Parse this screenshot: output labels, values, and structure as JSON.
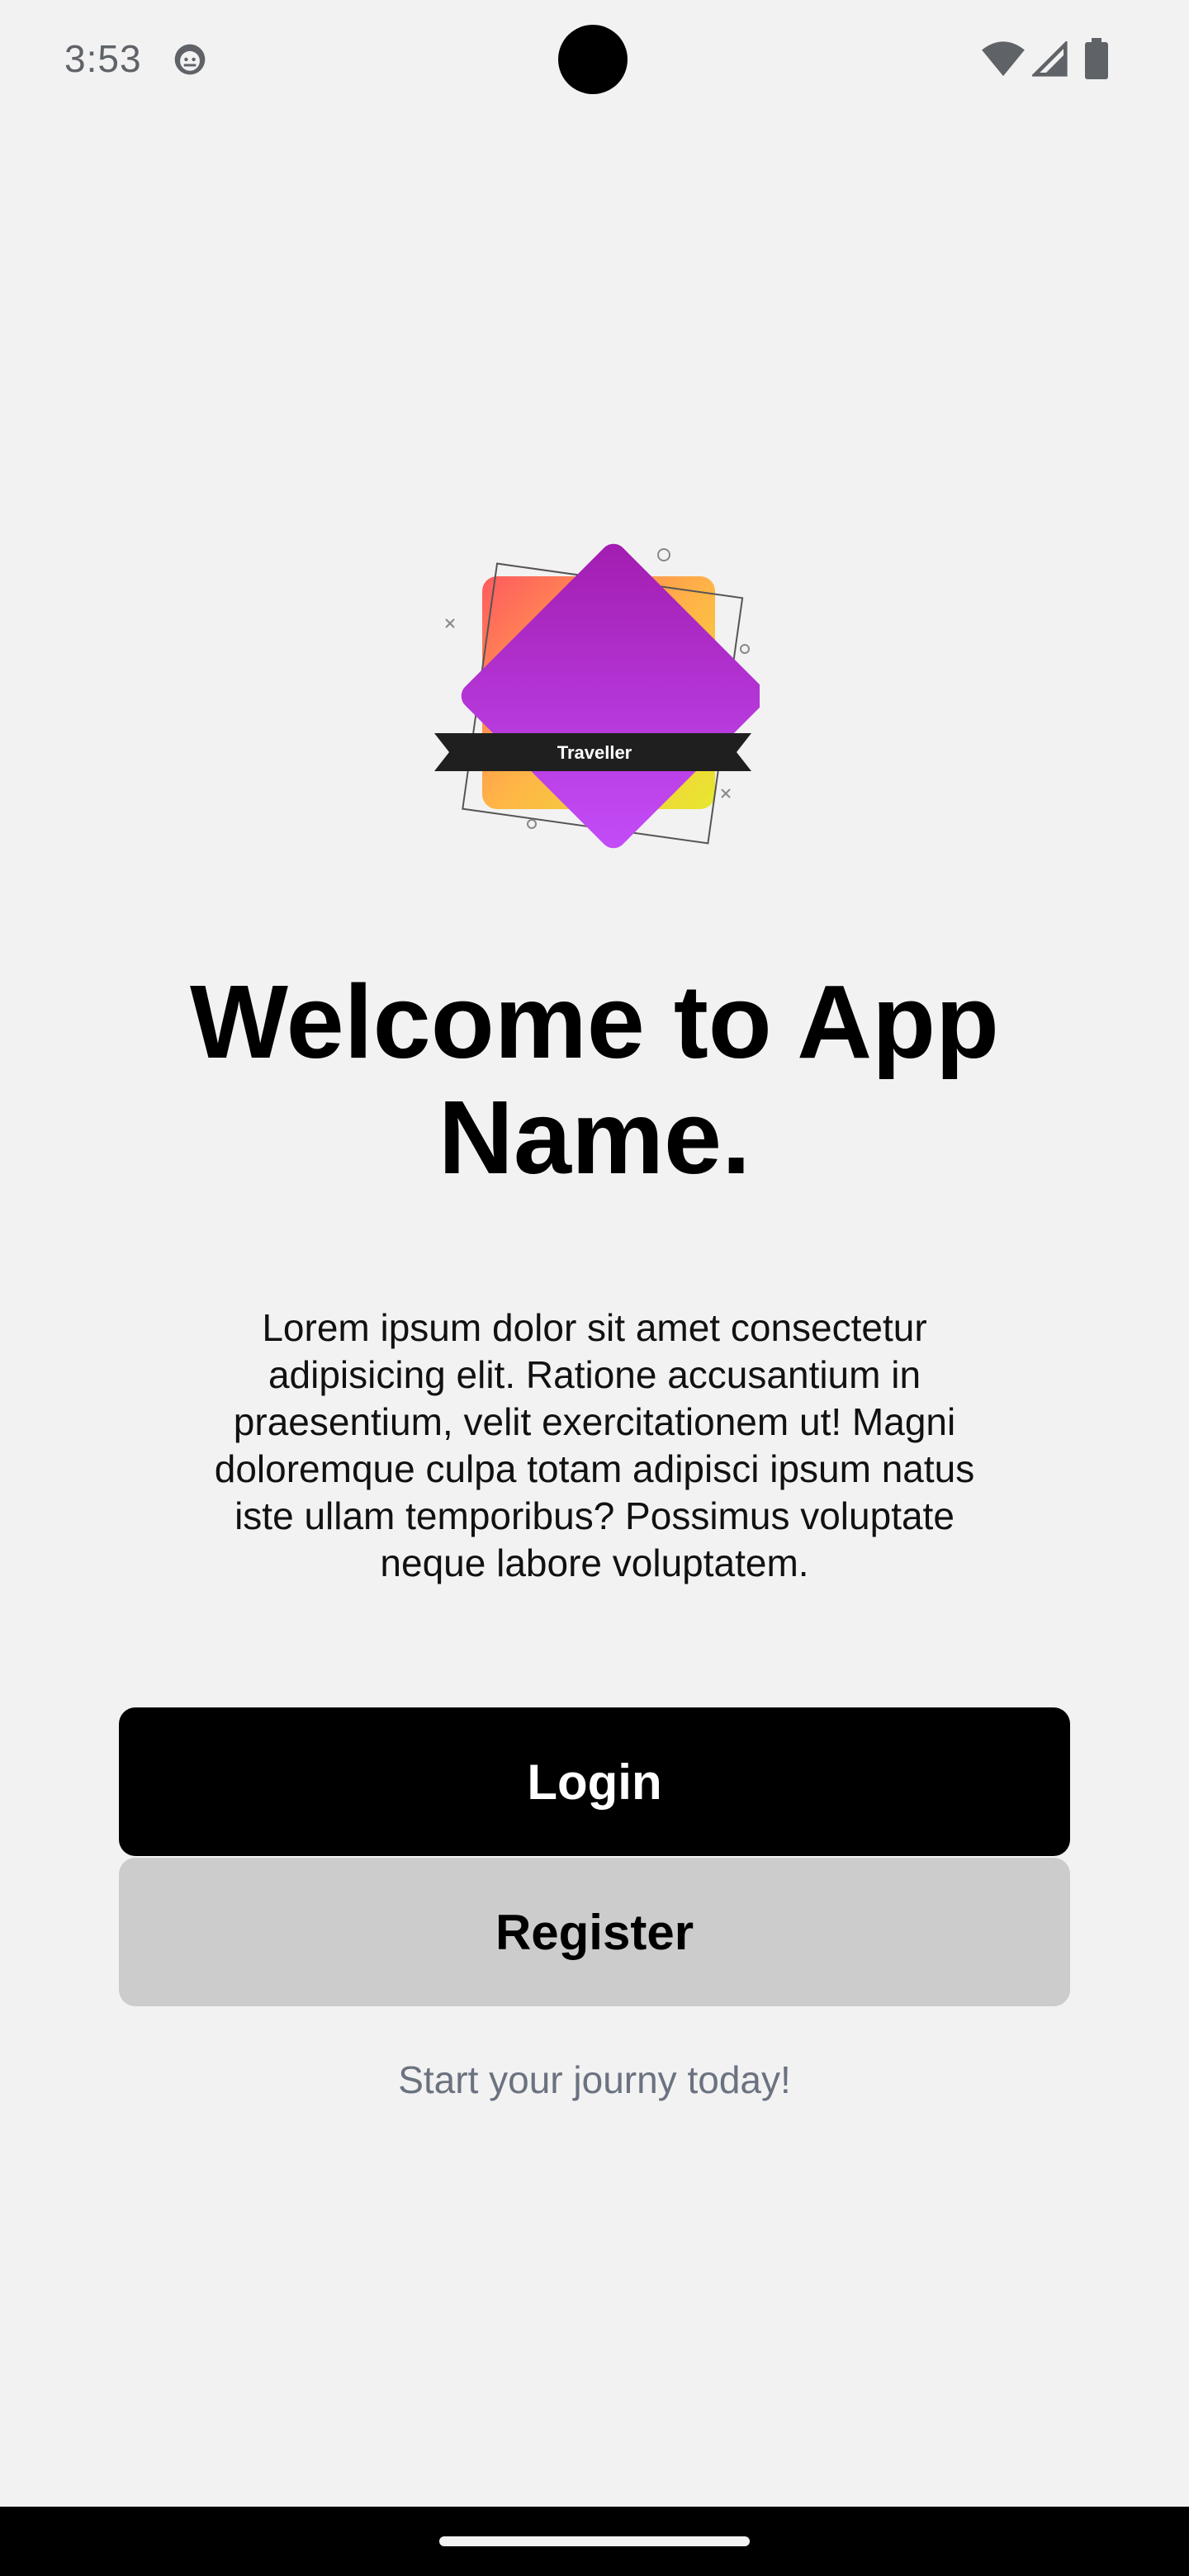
{
  "status_bar": {
    "time": "3:53",
    "app_icon": "android-debug-icon",
    "wifi_icon": "wifi-icon",
    "cell_icon": "cellular-signal-icon",
    "battery_icon": "battery-icon"
  },
  "logo": {
    "banner_text": "Traveller",
    "colors": {
      "diamond_start": "#a21caf",
      "diamond_end": "#c44dfa",
      "square_red": "#ff5a5f",
      "square_orange": "#ffb347",
      "square_yellow": "#e8e830",
      "banner": "#1f1f1f"
    }
  },
  "welcome": {
    "title": "Welcome to App Name.",
    "body": "Lorem ipsum dolor sit amet consectetur adipisicing elit. Ratione accusantium in praesentium, velit exercitationem ut! Magni doloremque culpa totam adipisci ipsum natus iste ullam temporibus? Possimus voluptate neque labore voluptatem."
  },
  "actions": {
    "login_label": "Login",
    "register_label": "Register"
  },
  "tagline": "Start your journy today!",
  "theme": {
    "background": "#f2f2f2",
    "primary_button": "#000000",
    "secondary_button": "#cccccc",
    "muted_text": "#6b7280"
  }
}
